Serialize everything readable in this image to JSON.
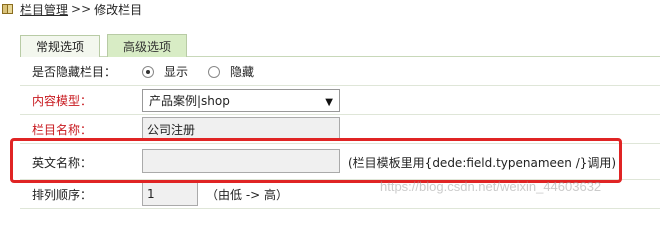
{
  "breadcrumb": {
    "root": "栏目管理",
    "sep": ">>",
    "current": "修改栏目"
  },
  "tabs": [
    {
      "label": "常规选项",
      "active": false
    },
    {
      "label": "高级选项",
      "active": true
    }
  ],
  "form": {
    "hidden": {
      "label": "是否隐藏栏目：",
      "options": [
        "显示",
        "隐藏"
      ],
      "selected": "显示"
    },
    "model": {
      "label": "内容模型：",
      "value": "产品案例|shop"
    },
    "name": {
      "label": "栏目名称：",
      "value": "公司注册"
    },
    "english": {
      "label": "英文名称：",
      "value": "",
      "hint": "(栏目模板里用{dede:field.typenameen /}调用)"
    },
    "order": {
      "label": "排列顺序：",
      "value": "1",
      "hint": "（由低 -> 高）"
    }
  },
  "colors": {
    "highlight": "#e02424",
    "label_required": "#c8191f",
    "tab_active": "#d8ecc5"
  },
  "watermark": "https://blog.csdn.net/weixin_44603632"
}
